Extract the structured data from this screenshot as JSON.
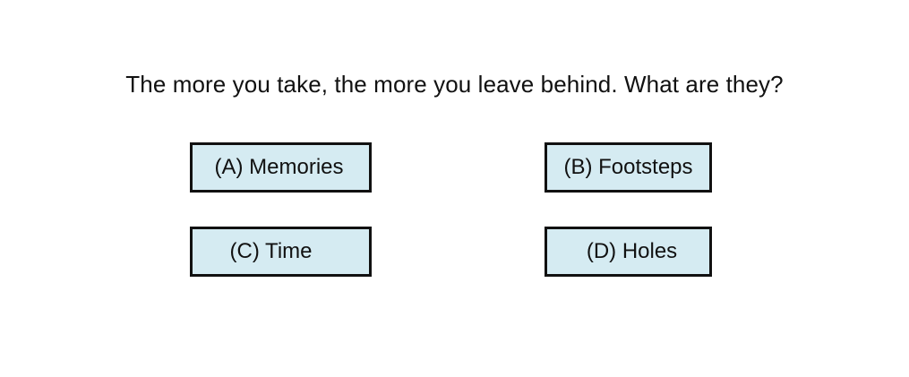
{
  "question": {
    "text": "The more you take, the more you leave behind. What are they?"
  },
  "options": [
    {
      "label": "(A) Memories"
    },
    {
      "label": "(B) Footsteps"
    },
    {
      "label": "(C) Time"
    },
    {
      "label": "(D) Holes"
    }
  ],
  "colors": {
    "option_background": "#d5ebf2",
    "option_border": "#111111",
    "text": "#111111",
    "page_background": "#ffffff"
  }
}
